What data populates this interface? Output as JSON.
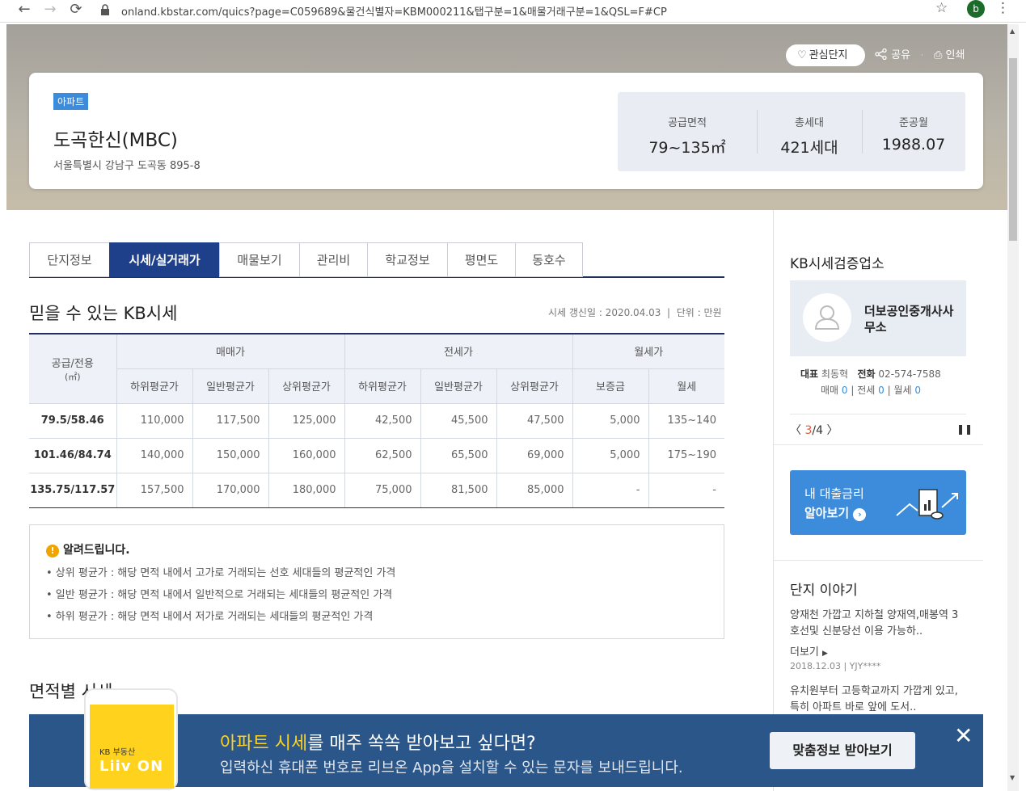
{
  "browser": {
    "url": "onland.kbstar.com/quics?page=C059689&물건식별자=KBM000211&탭구분=1&매물거래구분=1&QSL=F#CP",
    "profile_initial": "b"
  },
  "header": {
    "favorite_label": "관심단지",
    "share_label": "공유",
    "print_label": "인쇄",
    "type_tag": "아파트",
    "apt_name": "도곡한신(MBC)",
    "address": "서울특별시 강남구 도곡동 895-8",
    "stats": [
      {
        "label": "공급면적",
        "value": "79~135㎡"
      },
      {
        "label": "총세대",
        "value": "421세대"
      },
      {
        "label": "준공월",
        "value": "1988.07"
      }
    ]
  },
  "tabs": [
    "단지정보",
    "시세/실거래가",
    "매물보기",
    "관리비",
    "학교정보",
    "평면도",
    "동호수"
  ],
  "active_tab": "시세/실거래가",
  "price": {
    "title": "믿을 수 있는 KB시세",
    "updated": "시세 갱신일 : 2020.04.03",
    "unit": "단위 : 만원",
    "col_area": "공급/전용",
    "col_area_unit": "(㎡)",
    "groups": [
      "매매가",
      "전세가",
      "월세가"
    ],
    "subcols": [
      "하위평균가",
      "일반평균가",
      "상위평균가",
      "하위평균가",
      "일반평균가",
      "상위평균가",
      "보증금",
      "월세"
    ],
    "rows": [
      {
        "area": "79.5/58.46",
        "values": [
          "110,000",
          "117,500",
          "125,000",
          "42,500",
          "45,500",
          "47,500",
          "5,000",
          "135~140"
        ]
      },
      {
        "area": "101.46/84.74",
        "values": [
          "140,000",
          "150,000",
          "160,000",
          "62,500",
          "65,500",
          "69,000",
          "5,000",
          "175~190"
        ]
      },
      {
        "area": "135.75/117.57",
        "values": [
          "157,500",
          "170,000",
          "180,000",
          "75,000",
          "81,500",
          "85,000",
          "-",
          "-"
        ]
      }
    ]
  },
  "notice": {
    "title": "알려드립니다.",
    "lines": [
      "• 상위 평균가 : 해당 면적 내에서 고가로 거래되는 선호 세대들의 평균적인 가격",
      "• 일반 평균가 : 해당 면적 내에서 일반적으로 거래되는 세대들의 평균적인 가격",
      "• 하위 평균가 : 해당 면적 내에서 저가로 거래되는 세대들의 평균적인 가격"
    ]
  },
  "section2_title": "면적별 시세",
  "sidebar": {
    "agent_title": "KB시세검증업소",
    "agent_name": "더보공인중개사사무소",
    "rep_label": "대표",
    "rep_name": "최동혁",
    "phone_label": "전화",
    "phone": "02-574-7588",
    "sale_label": "매매",
    "sale_count": "0",
    "jeonse_label": "전세",
    "jeonse_count": "0",
    "monthly_label": "월세",
    "monthly_count": "0",
    "pager_current": "3",
    "pager_total": "/4",
    "loan_line1": "내 대출금리",
    "loan_line2": "알아보기",
    "story_title": "단지 이야기",
    "story1": "양재천 가깝고 지하철 양재역,매봉역 3호선및 신분당선 이용 가능하..",
    "more_label": "더보기",
    "story1_date": "2018.12.03 | YJY****",
    "story2": "유치원부터 고등학교까지 가깝게 있고, 특히 아파트 바로 앞에 도서.."
  },
  "app_banner": {
    "logo_small": "KB 부동산",
    "logo_big": "Liiv ON",
    "line1_highlight": "아파트 시세",
    "line1_rest": "를 매주 쏙쏙 받아보고 싶다면?",
    "line2": "입력하신 휴대폰 번호로 리브온 App을 설치할 수 있는 문자를 보내드립니다.",
    "button": "맞춤정보 받아보기"
  }
}
